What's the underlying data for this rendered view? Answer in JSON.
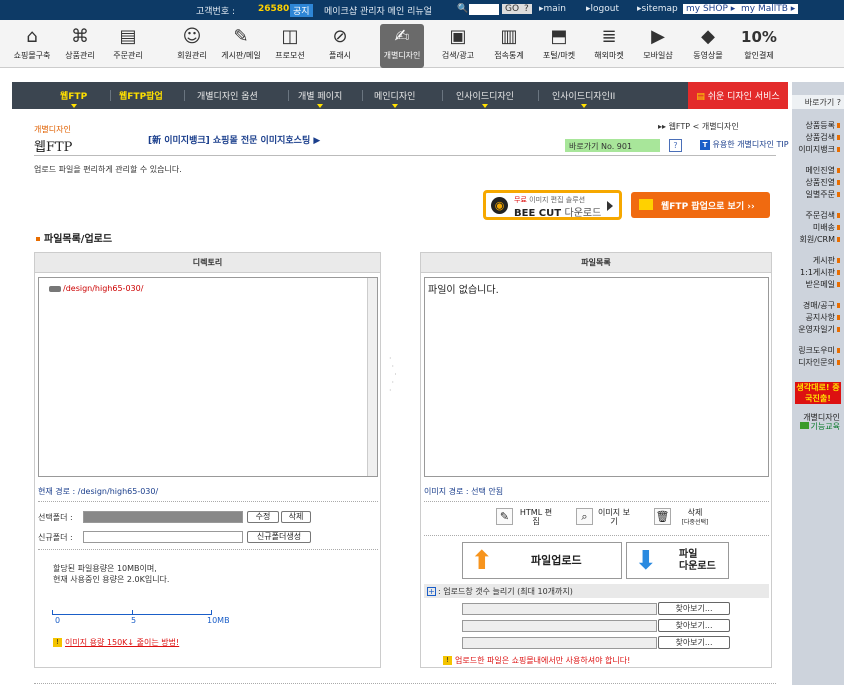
{
  "topbar": {
    "customer_label": "고객번호 :",
    "customer_no": "26580",
    "notice_badge": "공지",
    "notice": "메이크샵 관리자 메인 리뉴얼",
    "go": "GO",
    "help": "?",
    "links": [
      "▸main",
      "▸logout",
      "▸sitemap"
    ],
    "myshop": "my SHOP ▸",
    "mymall": "my MallTB ▸"
  },
  "menu": [
    "쇼핑몰구축",
    "상품관리",
    "주문관리",
    "회원관리",
    "게시판/메일",
    "프로모션",
    "플래시",
    "개별디자인",
    "검색/광고",
    "접속통계",
    "포털/마켓",
    "해외마켓",
    "모바일샵",
    "동영상몰",
    "할인결제"
  ],
  "menu_active": 7,
  "menu_icons": [
    "home-icon",
    "store-icon",
    "order-icon",
    "members-icon",
    "pencil-icon",
    "promo-icon",
    "flash-icon",
    "design-icon",
    "search-ad-icon",
    "stats-icon",
    "portal-icon",
    "global-market-icon",
    "mobile-shop-icon",
    "video-mall-icon",
    "discount-icon"
  ],
  "menu_discount_text": "10%",
  "nav": {
    "items": [
      "웹FTP",
      "웹FTP팝업",
      "개별디자인 옵션",
      "개별 페이지",
      "메인디자인",
      "인사이드디자인",
      "인사이드디자인II"
    ],
    "highlight": "쉬운 디자인 서비스"
  },
  "side": {
    "header": "바로가기 ?",
    "links": [
      "상품등록",
      "상품검색",
      "이미지뱅크",
      "메인진열",
      "상품진열",
      "일별주문",
      "주문검색",
      "미배송",
      "회원/CRM",
      "게시판",
      "1:1게시판",
      "받은메일",
      "경매/공구",
      "공지사항",
      "운영자일기",
      "링크도우미",
      "디자인문의"
    ],
    "badge": "생각대로! 중국진출!",
    "bottom1": "개별디자인",
    "bottom2": "기능교육"
  },
  "page": {
    "section": "개별디자인",
    "title": "웹FTP",
    "promo": "[新 이미지뱅크] 쇼핑몰 전문 이미지호스팅 ▶",
    "breadcrumb": "▸▸ 웹FTP < 개별디자인",
    "goto_label": "바로가기 No. 901",
    "help": "?",
    "tip": "유용한 개별디자인 TIP",
    "intro": "업로드 파일을 편리하게 관리할 수 있습니다.",
    "bee_line1a": "무료",
    "bee_line1b": "이미지 편집 솔루션",
    "bee_line2a": "BEE CUT",
    "bee_line2b": "다운로드",
    "popup_button": "웹FTP 팝업으로 보기 ››",
    "section_title": "파일목록/업로드"
  },
  "dir": {
    "header": "디렉토리",
    "entry": "/design/high65-030/",
    "current_path": "현재 경로 : /design/high65-030/",
    "selected_label": "선택폴더 :",
    "edit": "수정",
    "delete": "삭제",
    "new_label": "신규폴더 :",
    "create": "신규폴더생성",
    "quota1": "할당된 파일용량은 10MB이며,",
    "quota2": "현재 사용중인 용량은 2.0K입니다.",
    "scale": [
      "0",
      "5",
      "10MB"
    ],
    "tip_link": "이미지 용량 150K↓ 줄이는 방법!"
  },
  "files": {
    "header": "파일목록",
    "empty": "파일이 없습니다.",
    "image_path": "이미지 경로 : 선택 안됨",
    "html_edit": "HTML 편집",
    "image_view": "이미지 보기",
    "delete": "삭제",
    "delete_sub": "[다중선택]",
    "upload": "파일업로드",
    "download1": "파일",
    "download2": "다운로드",
    "expand": "업로드창 갯수 늘리기 (최대 10개까지)",
    "browse": "찾아보기...",
    "note": "업로드한 파일은 쇼핑몰내에서만 사용하셔야 합니다!"
  },
  "colors": {
    "accent": "#e86d00",
    "nav": "#3b4550",
    "topbar": "#0d3a66",
    "up": "#f7941d",
    "down": "#2a8ae0"
  }
}
